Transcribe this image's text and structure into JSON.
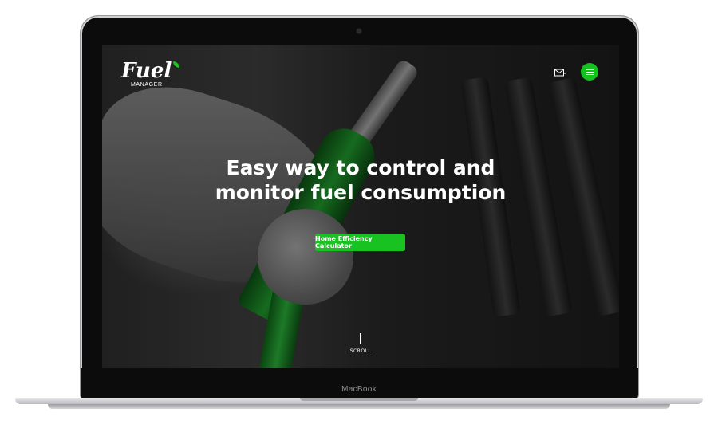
{
  "device": {
    "label": "MacBook"
  },
  "site": {
    "logo": {
      "word": "Fuel",
      "sub": "MANAGER"
    },
    "header": {
      "mail_icon": "mail-icon",
      "menu_icon": "hamburger-menu-icon"
    },
    "hero": {
      "headline_line1": "Easy way to control and",
      "headline_line2": "monitor fuel consumption",
      "cta_label": "Home Efficiency Calculator",
      "scroll_label": "SCROLL"
    }
  },
  "colors": {
    "accent_green": "#17c221",
    "nozzle_green": "#1e8f2a"
  }
}
